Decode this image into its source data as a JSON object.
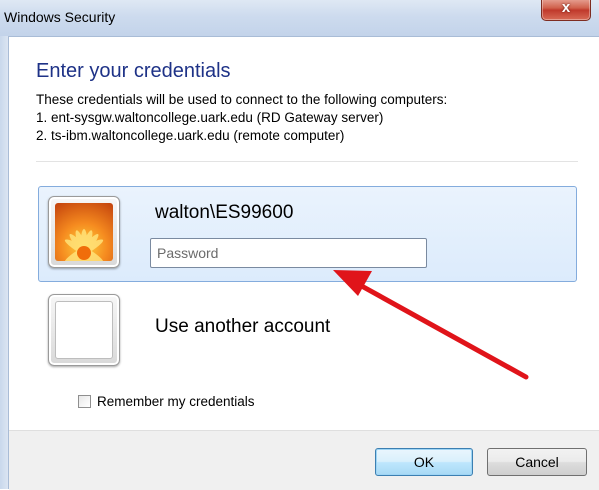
{
  "window": {
    "title": "Windows Security",
    "close_glyph": "x"
  },
  "dialog": {
    "heading": "Enter your credentials",
    "description": [
      "These credentials will be used to connect to the following computers:",
      "1. ent-sysgw.waltoncollege.uark.edu (RD Gateway server)",
      "2. ts-ibm.waltoncollege.uark.edu (remote computer)"
    ]
  },
  "account": {
    "username": "walton\\ES99600",
    "avatar_icon": "flower-user-tile-icon",
    "password_value": "",
    "password_placeholder": "Password"
  },
  "other_account": {
    "label": "Use another account",
    "avatar_icon": "blank-user-tile-icon"
  },
  "remember": {
    "label": "Remember my credentials",
    "checked": false
  },
  "buttons": {
    "ok_label": "OK",
    "cancel_label": "Cancel"
  },
  "annotation": {
    "arrow_icon": "red-arrow-icon",
    "color": "#e0141a"
  },
  "colors": {
    "heading": "#1e3287",
    "selected_tile_border": "#84acdd",
    "close_button": "#c0392b"
  }
}
